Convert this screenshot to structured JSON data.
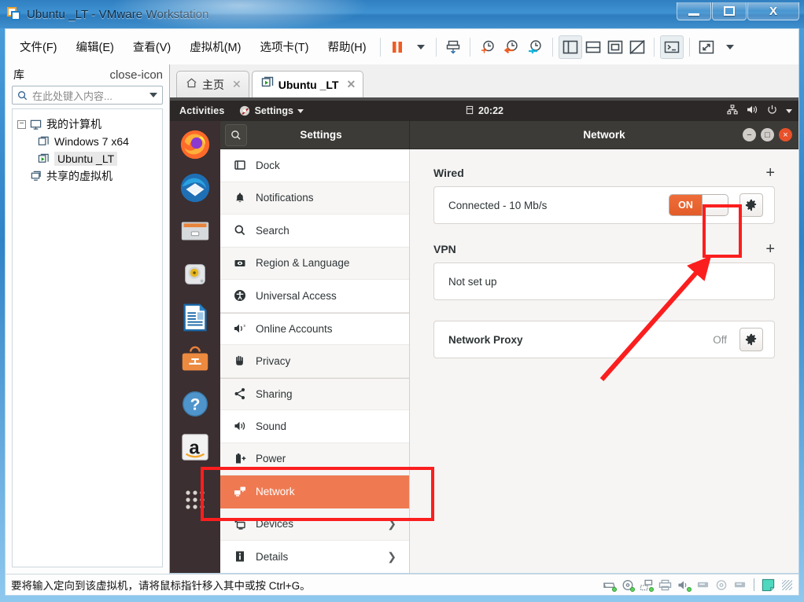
{
  "window": {
    "title": "Ubuntu _LT - VMware Workstation",
    "app_icon": "vmware-logo-icon",
    "controls": {
      "minimize": "minimize-icon",
      "maximize": "maximize-icon",
      "close": "X"
    }
  },
  "menubar": {
    "items": [
      {
        "label": "文件(F)",
        "name": "menu-file"
      },
      {
        "label": "编辑(E)",
        "name": "menu-edit"
      },
      {
        "label": "查看(V)",
        "name": "menu-view"
      },
      {
        "label": "虚拟机(M)",
        "name": "menu-vm"
      },
      {
        "label": "选项卡(T)",
        "name": "menu-tabs"
      },
      {
        "label": "帮助(H)",
        "name": "menu-help"
      }
    ]
  },
  "toolbar": {
    "buttons": [
      {
        "name": "suspend-button",
        "icon": "pause-icon"
      },
      {
        "name": "suspend-dropdown",
        "icon": "chevron-down-icon"
      },
      {
        "name": "snapshot-manager-button",
        "icon": "snapshot-icon"
      },
      {
        "name": "take-snapshot-button",
        "icon": "clock-plus-icon"
      },
      {
        "name": "revert-snapshot-button",
        "icon": "clock-back-icon"
      },
      {
        "name": "manage-snapshots-button",
        "icon": "clock-wrench-icon"
      },
      {
        "name": "show-library-button",
        "icon": "panel-left-icon"
      },
      {
        "name": "show-thumbnail-bar-button",
        "icon": "panel-bottom-icon"
      },
      {
        "name": "show-console-view-button",
        "icon": "console-view-icon"
      },
      {
        "name": "hide-console-view-button",
        "icon": "console-hidden-icon"
      },
      {
        "name": "unity-mode-button",
        "icon": "terminal-icon"
      },
      {
        "name": "fullscreen-button",
        "icon": "expand-icon"
      },
      {
        "name": "fullscreen-dropdown",
        "icon": "chevron-down-icon"
      }
    ]
  },
  "library": {
    "title": "库",
    "close_icon": "close-icon",
    "search": {
      "placeholder": "在此处键入内容...",
      "icon": "search-icon",
      "dropdown_icon": "chevron-down-icon"
    },
    "tree": [
      {
        "label": "我的计算机",
        "icon": "computer-icon",
        "level": 0,
        "expander": "−",
        "selected": false
      },
      {
        "label": "Windows 7 x64",
        "icon": "vm-stopped-icon",
        "level": 1,
        "selected": false
      },
      {
        "label": "Ubuntu _LT",
        "icon": "vm-running-icon",
        "level": 1,
        "selected": true
      },
      {
        "label": "共享的虚拟机",
        "icon": "shared-vms-icon",
        "level": 0,
        "selected": false
      }
    ]
  },
  "tabs": [
    {
      "label": "主页",
      "icon": "home-icon",
      "active": false,
      "close_icon": "close-icon"
    },
    {
      "label": "Ubuntu _LT",
      "icon": "vm-running-icon",
      "active": true,
      "close_icon": "close-icon"
    }
  ],
  "guest": {
    "topbar": {
      "activities": "Activities",
      "app_menu": {
        "label": "Settings",
        "icon": "settings-app-icon",
        "caret": "chevron-down-icon"
      },
      "clock": {
        "text": "20:22",
        "icon": "calendar-icon"
      },
      "tray": [
        {
          "name": "network-icon"
        },
        {
          "name": "volume-icon"
        },
        {
          "name": "power-icon"
        },
        {
          "name": "chevron-down-icon"
        }
      ]
    },
    "dock": [
      {
        "name": "firefox-icon",
        "label": "Firefox"
      },
      {
        "name": "thunderbird-icon",
        "label": "Thunderbird"
      },
      {
        "name": "files-icon",
        "label": "Files"
      },
      {
        "name": "rhythmbox-icon",
        "label": "Rhythmbox"
      },
      {
        "name": "libreoffice-writer-icon",
        "label": "LibreOffice Writer"
      },
      {
        "name": "ubuntu-software-icon",
        "label": "Ubuntu Software"
      },
      {
        "name": "help-icon",
        "label": "Help"
      },
      {
        "name": "amazon-icon",
        "label": "Amazon"
      },
      {
        "name": "show-applications-icon",
        "label": "Show Applications"
      }
    ],
    "settings_window": {
      "header": {
        "search_icon": "search-icon",
        "sidebar_title": "Settings",
        "panel_title": "Network",
        "minimize": "−",
        "maximize": "□",
        "close": "×"
      },
      "sidebar_items": [
        {
          "label": "Dock",
          "icon": "dock-icon",
          "selected": false,
          "chevron": false
        },
        {
          "label": "Notifications",
          "icon": "bell-icon",
          "selected": false,
          "chevron": false
        },
        {
          "label": "Search",
          "icon": "search-icon",
          "selected": false,
          "chevron": false
        },
        {
          "label": "Region & Language",
          "icon": "flag-icon",
          "selected": false,
          "chevron": false
        },
        {
          "label": "Universal Access",
          "icon": "accessibility-icon",
          "selected": false,
          "chevron": false
        },
        {
          "label": "Online Accounts",
          "icon": "online-accounts-icon",
          "selected": false,
          "chevron": false
        },
        {
          "label": "Privacy",
          "icon": "hand-icon",
          "selected": false,
          "chevron": false
        },
        {
          "label": "Sharing",
          "icon": "share-icon",
          "selected": false,
          "chevron": false
        },
        {
          "label": "Sound",
          "icon": "speaker-icon",
          "selected": false,
          "chevron": false
        },
        {
          "label": "Power",
          "icon": "battery-icon",
          "selected": false,
          "chevron": false
        },
        {
          "label": "Network",
          "icon": "network-icon",
          "selected": true,
          "chevron": false
        },
        {
          "label": "Devices",
          "icon": "devices-icon",
          "selected": false,
          "chevron": true
        },
        {
          "label": "Details",
          "icon": "info-icon",
          "selected": false,
          "chevron": true
        }
      ],
      "panel": {
        "sections": [
          {
            "title": "Wired",
            "add_label": "+",
            "rows": [
              {
                "label": "Connected - 10 Mb/s",
                "toggle": "ON",
                "gear": "gear-icon"
              }
            ]
          },
          {
            "title": "VPN",
            "add_label": "+",
            "rows": [
              {
                "label": "Not set up"
              }
            ]
          },
          {
            "title": "",
            "rows": [
              {
                "label": "Network Proxy",
                "bold": true,
                "status": "Off",
                "gear": "gear-icon"
              }
            ]
          }
        ]
      }
    }
  },
  "statusbar": {
    "message": "要将输入定向到该虚拟机，请将鼠标指针移入其中或按 Ctrl+G。",
    "icons": [
      {
        "name": "hard-disk-icon",
        "active": true
      },
      {
        "name": "cd-dvd-icon",
        "active": true
      },
      {
        "name": "network-adapter-icon",
        "active": true
      },
      {
        "name": "printer-icon",
        "active": false
      },
      {
        "name": "sound-card-icon",
        "active": true
      },
      {
        "name": "usb-device-icon",
        "active": false
      },
      {
        "name": "optical-drive-icon",
        "active": false
      },
      {
        "name": "usb-device-2-icon",
        "active": false
      },
      {
        "name": "message-log-icon",
        "active": false
      }
    ]
  },
  "annotations": {
    "highlight_color": "#fb1e1e",
    "boxes": [
      {
        "name": "gear-button-highlight"
      },
      {
        "name": "network-item-highlight"
      }
    ],
    "arrow": {
      "name": "pointer-arrow",
      "from": "network-proxy-row",
      "to": "wired-gear-button"
    }
  },
  "colors": {
    "accent_orange": "#ef7a52",
    "toggle_on": "#e8642c",
    "annotation_red": "#fb1e1e",
    "ubuntu_bar": "#2b2827",
    "dock_bg": "#3b2f31"
  }
}
